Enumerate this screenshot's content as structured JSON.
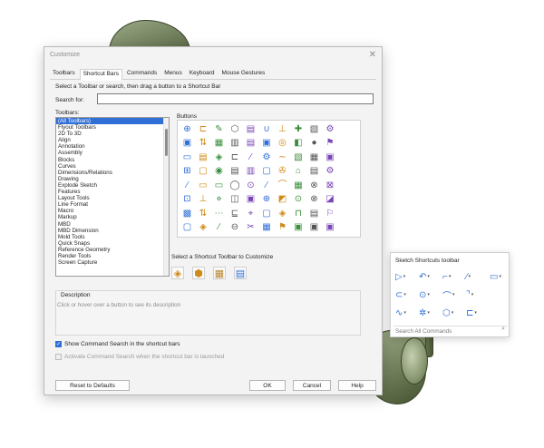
{
  "dialog": {
    "title": "Customize",
    "close_glyph": "✕",
    "tabs": [
      {
        "label": "Toolbars",
        "active": false
      },
      {
        "label": "Shortcut Bars",
        "active": true
      },
      {
        "label": "Commands",
        "active": false
      },
      {
        "label": "Menus",
        "active": false
      },
      {
        "label": "Keyboard",
        "active": false
      },
      {
        "label": "Mouse Gestures",
        "active": false
      }
    ],
    "instructions": "Select a Toolbar or search, then drag a button to a Shortcut Bar",
    "search_label": "Search for:",
    "search_value": "",
    "toolbars_label": "Toolbars:",
    "toolbars": [
      "(All Toolbars)",
      "Flyout Toolbars",
      "2D To 3D",
      "Align",
      "Annotation",
      "Assembly",
      "Blocks",
      "Curves",
      "Dimensions/Relations",
      "Drawing",
      "Explode Sketch",
      "Features",
      "Layout Tools",
      "Line Format",
      "Macro",
      "Markup",
      "MBD",
      "MBD Dimension",
      "Mold Tools",
      "Quick Snaps",
      "Reference Geometry",
      "Render Tools",
      "Screen Capture"
    ],
    "selected_toolbar_index": 0,
    "buttons_label": "Buttons",
    "button_glyphs": [
      "⊕",
      "⊏",
      "✎",
      "⬡",
      "▤",
      "∪",
      "⊥",
      "✚",
      "▧",
      "⚙",
      "▣",
      "⇅",
      "▦",
      "▥",
      "▤",
      "▣",
      "◎",
      "◧",
      "●",
      "⚑",
      "▭",
      "▤",
      "◈",
      "⊏",
      "∕",
      "⚙",
      "∼",
      "▧",
      "▦",
      "▣",
      "⊞",
      "▢",
      "◉",
      "▤",
      "▥",
      "▢",
      "✇",
      "⌂",
      "▤",
      "⚙",
      "∕",
      "▭",
      "▭",
      "◯",
      "⊙",
      "∕",
      "⌒",
      "▦",
      "⊗",
      "⊠",
      "⊡",
      "⊥",
      "⋄",
      "◫",
      "▣",
      "⊕",
      "◩",
      "⊙",
      "⊗",
      "◪",
      "▩",
      "⇅",
      "⋯",
      "⊑",
      "⌖",
      "▢",
      "◈",
      "⊓",
      "▤",
      "⚐",
      "▢",
      "◈",
      "∕",
      "⊖",
      "✂",
      "▦",
      "⚑",
      "▣",
      "▣",
      "▣",
      "▤"
    ],
    "select_label": "Select a Shortcut Toolbar to Customize",
    "shortcut_toolbars": [
      "part-shortcut-icon",
      "assembly-shortcut-icon",
      "drawing-shortcut-icon",
      "sketch-shortcut-icon"
    ],
    "shortcut_glyphs": [
      "◈",
      "⬢",
      "▦",
      "▤"
    ],
    "description_title": "Description",
    "description_text": "Click or hover over a button to see its description",
    "check_show_search": {
      "label": "Show Command Search in the shortcut bars",
      "checked": true
    },
    "check_activate_search": {
      "label": "Activate Command Search when the shortcut bar is launched",
      "checked": false,
      "enabled": false
    },
    "check_mark": "✓",
    "buttons": {
      "reset": "Reset to Defaults",
      "ok": "OK",
      "cancel": "Cancel",
      "help": "Help"
    }
  },
  "popup": {
    "title": "Sketch Shortcuts toolbar",
    "rows": [
      [
        {
          "glyph": "▷",
          "name": "select-icon"
        },
        {
          "glyph": "↶",
          "name": "rotate-icon"
        },
        {
          "glyph": "⌐",
          "name": "corner-rectangle-icon"
        },
        {
          "glyph": "∕",
          "name": "line-icon"
        },
        {
          "glyph": "▭",
          "name": "rectangle-icon"
        }
      ],
      [
        {
          "glyph": "⊂",
          "name": "slot-icon"
        },
        {
          "glyph": "⊙",
          "name": "circle-icon"
        },
        {
          "glyph": "⌒",
          "name": "arc-icon"
        },
        {
          "glyph": "⌝",
          "name": "fillet-icon"
        }
      ],
      [
        {
          "glyph": "∿",
          "name": "spline-icon"
        },
        {
          "glyph": "✲",
          "name": "trim-icon"
        },
        {
          "glyph": "⬡",
          "name": "feature-icon"
        },
        {
          "glyph": "⊏",
          "name": "offset-icon"
        }
      ]
    ],
    "caret": "▾",
    "search_placeholder": "Search All Commands",
    "search_glyph": "⌕"
  }
}
